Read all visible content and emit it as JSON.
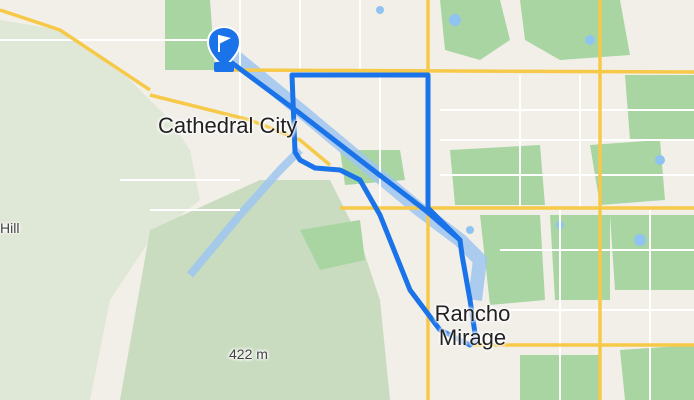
{
  "map": {
    "labels": {
      "cathedral_city": "Cathedral City",
      "rancho_mirage_line1": "Rancho",
      "rancho_mirage_line2": "Mirage",
      "elevation": "422 m",
      "hill": "Hill"
    },
    "colors": {
      "route": "#1a73e8",
      "route_highlight": "#5b9bf0",
      "park": "#a8d5a2",
      "mountain": "#c9dcc0",
      "water": "#8ec3f2",
      "major_road": "#f7c948",
      "street": "#ffffff",
      "background": "#f2efe9"
    },
    "marker": {
      "type": "start-flag",
      "icon": "flag-icon",
      "color": "#1a73e8"
    }
  }
}
